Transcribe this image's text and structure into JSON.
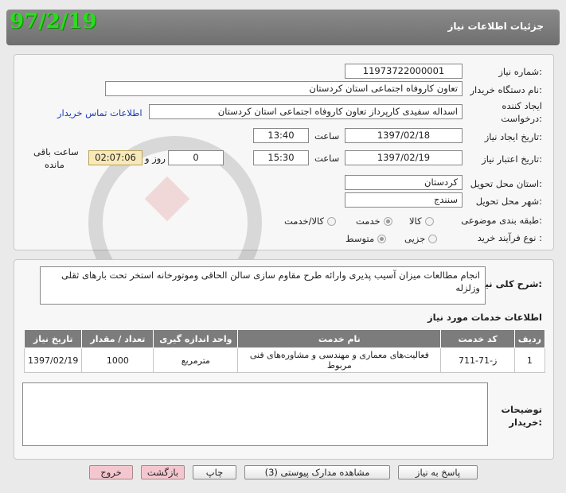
{
  "header": {
    "title": "جزئیات اطلاعات نیاز",
    "date_stamp": "97/2/19"
  },
  "info": {
    "need_number_label": "شماره نیاز:",
    "need_number": "1197372200000‌1",
    "buyer_org_label": "نام دستگاه خریدار:",
    "buyer_org": "تعاون کاروفاه اجتماعی استان کردستان",
    "requester_label_1": "ایجاد کننده",
    "requester_label_2": "درخواست:",
    "requester": "اسداله سفیدی کارپرداز تعاون کاروفاه اجتماعی استان کردستان",
    "contact_link": "اطلاعات تماس خریدار",
    "created_date_label": "تاریخ ایجاد نیاز:",
    "created_date": "1397/02/18",
    "time_label": "ساعت",
    "created_time": "13:40",
    "validity_label": "تاریخ اعتبار نیاز:",
    "validity_date": "1397/02/19",
    "validity_time": "15:30",
    "days_value": "0",
    "days_label": "روز و",
    "remaining_time": "02:07:06",
    "remaining_label_1": "ساعت باقی",
    "remaining_label_2": "مانده",
    "province_label": "استان محل تحویل:",
    "province": "کردستان",
    "city_label": "شهر محل تحویل:",
    "city": "سنندج",
    "category_label": "طبقه بندی موضوعی:",
    "category_options": [
      "کالا",
      "خدمت",
      "کالا/خدمت"
    ],
    "category_selected": "خدمت",
    "process_label": "نوع فرآیند خرید :",
    "process_options": [
      "جزیی",
      "متوسط"
    ],
    "process_selected": "متوسط"
  },
  "description": {
    "label": "شرح کلی نیاز:",
    "text": "انجام مطالعات میزان آسیب پذیری وارائه طرح مقاوم سازی سالن الحاقی وموتورخانه استخر تحت بارهای ثقلی وزلزله"
  },
  "services": {
    "title": "اطلاعات خدمات مورد نیاز",
    "columns": [
      "ردیف",
      "کد خدمت",
      "نام خدمت",
      "واحد اندازه گیری",
      "تعداد / مقدار",
      "تاریخ نیاز"
    ],
    "rows": [
      {
        "row": "1",
        "code": "ز-71-711",
        "name": "فعالیت‌های معماری و مهندسی و مشاوره‌های فنی مربوط",
        "unit": "مترمربع",
        "qty": "1000",
        "date": "1397/02/19"
      }
    ]
  },
  "buyer_notes": {
    "label_1": "توضیحات",
    "label_2": "خریدار:",
    "text": ""
  },
  "buttons": {
    "reply": "پاسخ به نیاز",
    "attachments": "مشاهده مدارک پیوستی (3)",
    "print": "چاپ",
    "back": "بازگشت",
    "exit": "خروج"
  },
  "colors": {
    "header_bg": "#7a7a7a",
    "date_stamp": "#2bdc1e",
    "link": "#1a3fb0",
    "table_header": "#7c7c7c",
    "pink_button": "#f4c7cf"
  }
}
